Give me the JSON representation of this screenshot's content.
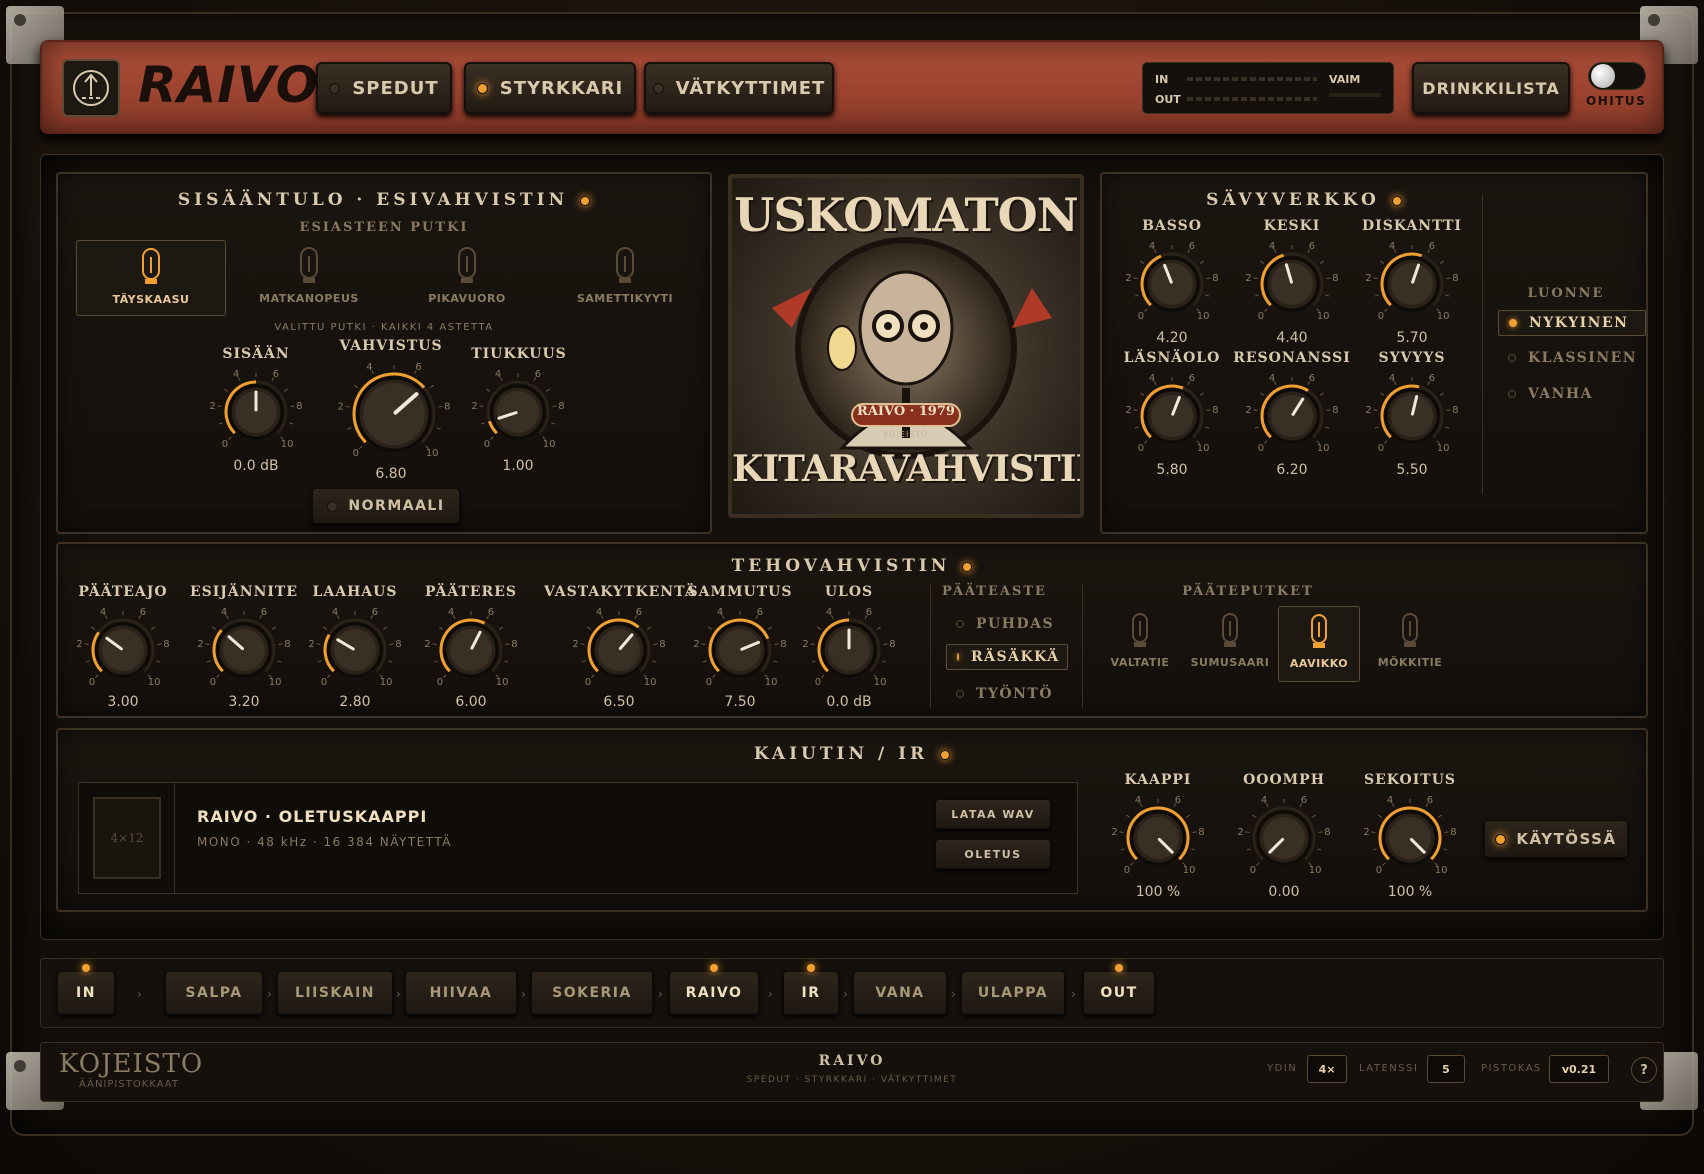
{
  "header": {
    "brand": "RAIVO",
    "tabs": [
      {
        "label": "SPEDUT",
        "active": false
      },
      {
        "label": "STYRKKARI",
        "active": true
      },
      {
        "label": "VÄTKYTTIMET",
        "active": false
      }
    ],
    "meter": {
      "in_label": "IN",
      "out_label": "OUT",
      "mute_label": "VAIM"
    },
    "drink_list_label": "DRINKKILISTA",
    "bypass_label": "OHITUS"
  },
  "input_panel": {
    "title": "SISÄÄNTULO · ESIVAHVISTIN",
    "subtitle": "ESIASTEEN PUTKI",
    "tubes": [
      {
        "label": "TÄYSKAASU",
        "selected": true
      },
      {
        "label": "MATKANOPEUS",
        "selected": false
      },
      {
        "label": "PIKAVUORO",
        "selected": false
      },
      {
        "label": "SAMETTIKYYTI",
        "selected": false
      }
    ],
    "note": "VALITTU PUTKI · KAIKKI 4 ASTETTA",
    "knobs": [
      {
        "label": "SISÄÄN",
        "value": "0.0 dB",
        "level": 5.0
      },
      {
        "label": "VAHVISTUS",
        "value": "6.80",
        "level": 6.8
      },
      {
        "label": "TIUKKUUS",
        "value": "1.00",
        "level": 1.0
      }
    ],
    "mode_button": "NORMAALI"
  },
  "artwork": {
    "top_text": "USKOMATON",
    "bottom_text": "KITARAVAHVISTIN",
    "badge": "RAIVO · 1979",
    "maker": "KOJEISTO"
  },
  "tone_panel": {
    "title": "SÄVYVERKKO",
    "knobs": [
      {
        "label": "BASSO",
        "value": "4.20",
        "level": 4.2
      },
      {
        "label": "KESKI",
        "value": "4.40",
        "level": 4.4
      },
      {
        "label": "DISKANTTI",
        "value": "5.70",
        "level": 5.7
      },
      {
        "label": "LÄSNÄOLO",
        "value": "5.80",
        "level": 5.8
      },
      {
        "label": "RESONANSSI",
        "value": "6.20",
        "level": 6.2
      },
      {
        "label": "SYVYYS",
        "value": "5.50",
        "level": 5.5
      }
    ],
    "character_title": "LUONNE",
    "characters": [
      {
        "label": "NYKYINEN",
        "selected": true
      },
      {
        "label": "KLASSINEN",
        "selected": false
      },
      {
        "label": "VANHA",
        "selected": false
      }
    ]
  },
  "power_panel": {
    "title": "TEHOVAHVISTIN",
    "knobs": [
      {
        "label": "PÄÄTEAJO",
        "value": "3.00",
        "level": 3.0
      },
      {
        "label": "ESIJÄNNITE",
        "value": "3.20",
        "level": 3.2
      },
      {
        "label": "LAAHAUS",
        "value": "2.80",
        "level": 2.8
      },
      {
        "label": "PÄÄTERES",
        "value": "6.00",
        "level": 6.0
      },
      {
        "label": "VASTAKYTKENTÄ",
        "value": "6.50",
        "level": 6.5
      },
      {
        "label": "SAMMUTUS",
        "value": "7.50",
        "level": 7.5
      },
      {
        "label": "ULOS",
        "value": "0.0 dB",
        "level": 5.0
      }
    ],
    "stage_title": "PÄÄTEASTE",
    "stages": [
      {
        "label": "PUHDAS",
        "selected": false
      },
      {
        "label": "RÄSÄKKÄ",
        "selected": true
      },
      {
        "label": "TYÖNTÖ",
        "selected": false
      }
    ],
    "tubes_title": "PÄÄTEPUTKET",
    "tubes": [
      {
        "label": "VALTATIE",
        "selected": false
      },
      {
        "label": "SUMUSAARI",
        "selected": false
      },
      {
        "label": "AAVIKKO",
        "selected": true
      },
      {
        "label": "MÖKKITIE",
        "selected": false
      }
    ]
  },
  "cab_panel": {
    "title": "KAIUTIN / IR",
    "thumb_label": "4×12",
    "ir_name": "RAIVO · OLETUSKAAPPI",
    "ir_meta": "MONO · 48 kHz · 16 384 NÄYTETTÄ",
    "load_button": "LATAA WAV",
    "default_button": "OLETUS",
    "knobs": [
      {
        "label": "KAAPPI",
        "value": "100 %",
        "level": 10
      },
      {
        "label": "OOOMPH",
        "value": "0.00",
        "level": 0
      },
      {
        "label": "SEKOITUS",
        "value": "100 %",
        "level": 10
      }
    ],
    "enable_button": "KÄYTÖSSÄ"
  },
  "chain": [
    {
      "label": "IN",
      "on": true
    },
    {
      "label": "SALPA",
      "on": false
    },
    {
      "label": "LIISKAIN",
      "on": false
    },
    {
      "label": "HIIVAA",
      "on": false
    },
    {
      "label": "SOKERIA",
      "on": false
    },
    {
      "label": "RAIVO",
      "on": true
    },
    {
      "label": "IR",
      "on": true
    },
    {
      "label": "VANA",
      "on": false
    },
    {
      "label": "ULAPPA",
      "on": false
    },
    {
      "label": "OUT",
      "on": true
    }
  ],
  "footer": {
    "brand": "KOJEISTO",
    "brand_sub": "ÄÄNIPISTOKKAAT",
    "center_title": "RAIVO",
    "center_sub": "SPEDUT · STYRKKARI · VÄTKYTTIMET",
    "core_label": "YDIN",
    "core_value": "4×",
    "latency_label": "LATENSSI",
    "latency_value": "5",
    "plugin_label": "PISTOKAS",
    "version": "v0.21",
    "help": "?"
  },
  "colors": {
    "accent": "#f0a030",
    "header_red": "#a84a34",
    "panel": "#1b1510",
    "text": "#d9c9ad"
  },
  "knob_scale": {
    "ticks": [
      "0",
      "2",
      "4",
      "6",
      "8",
      "10"
    ],
    "max": 10
  }
}
